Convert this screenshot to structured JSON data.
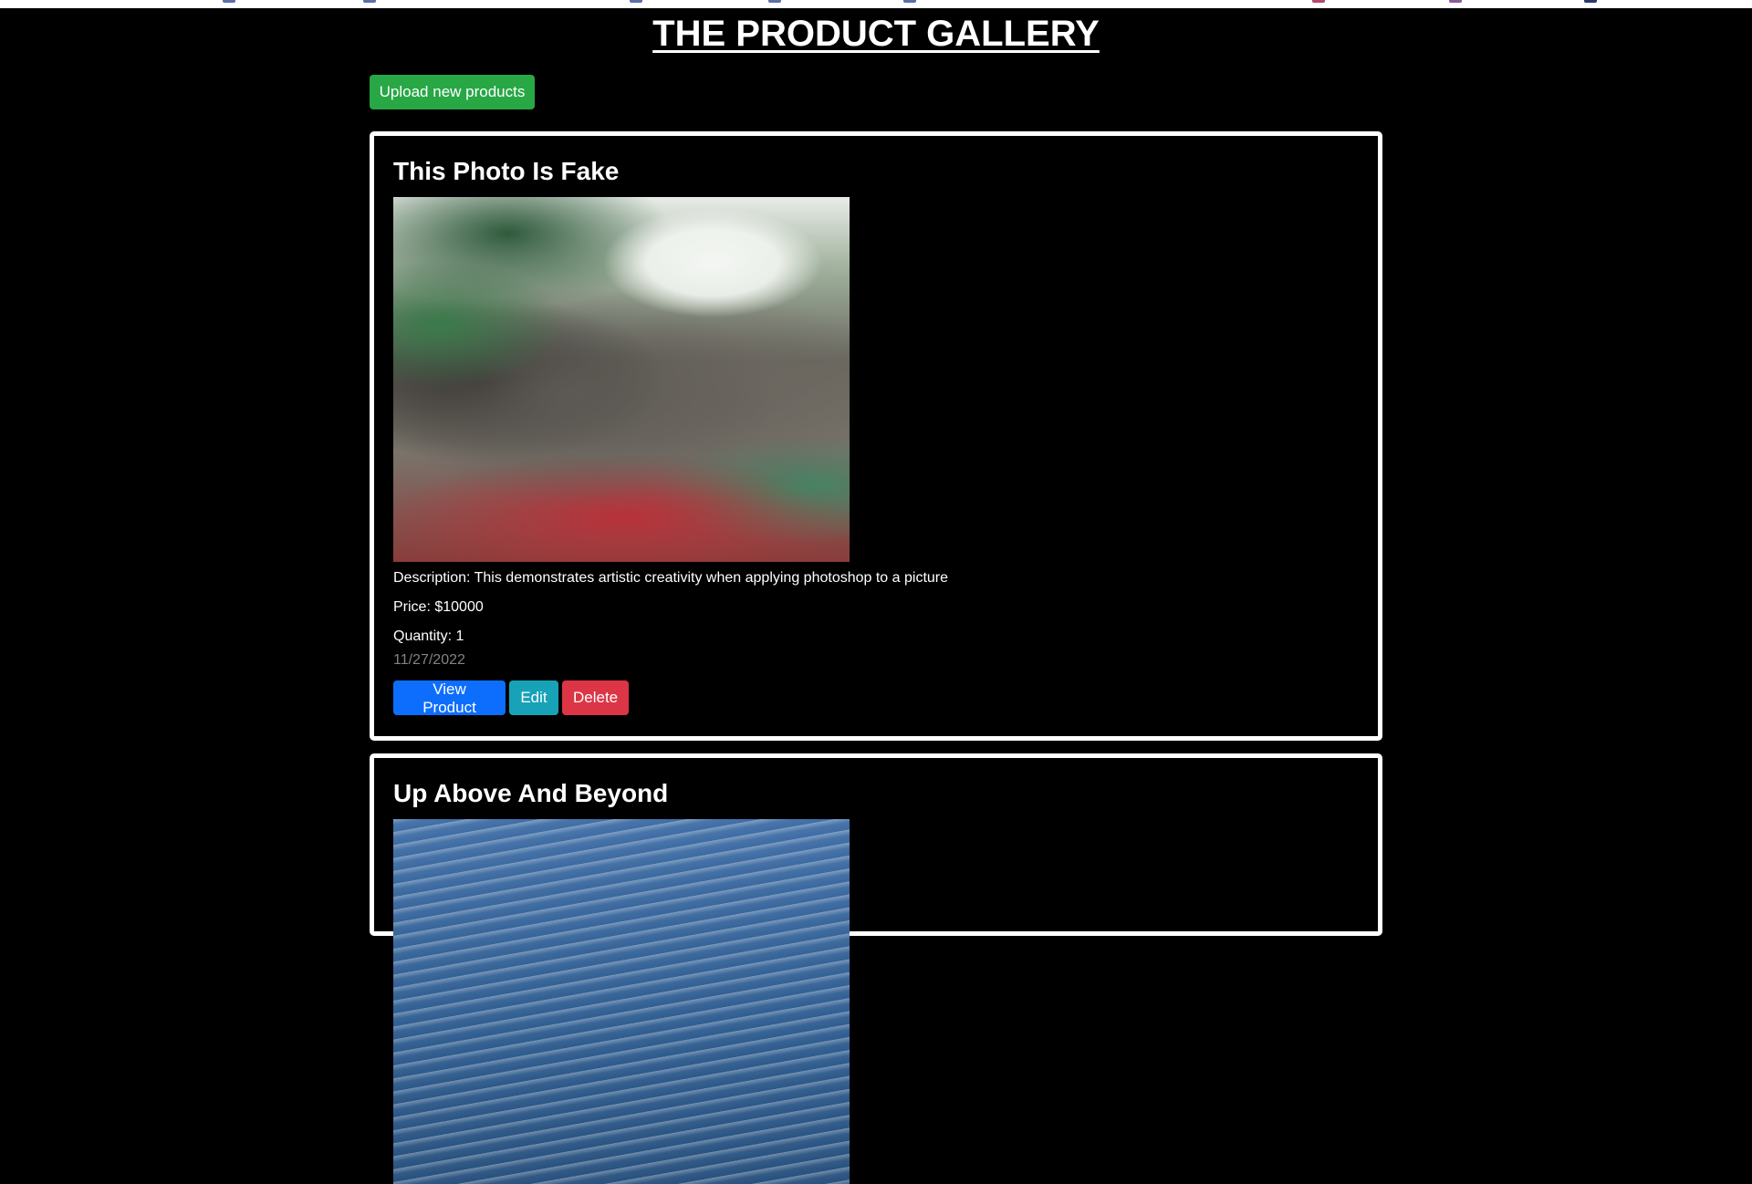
{
  "page": {
    "title": "THE PRODUCT GALLERY",
    "upload_label": "Upload new products"
  },
  "products": [
    {
      "title": "This Photo Is Fake",
      "image": "photo-logs-grass",
      "description": "Description: This demonstrates artistic creativity when applying photoshop to a picture",
      "price": "Price: $10000",
      "quantity": "Quantity: 1",
      "date": "11/27/2022",
      "view_label": "View Product",
      "edit_label": "Edit",
      "delete_label": "Delete"
    },
    {
      "title": "Up Above And Beyond",
      "image": "photo-ocean-waves"
    }
  ],
  "colors": {
    "background": "#000000",
    "upload": "#28a745",
    "view": "#0d6efd",
    "edit": "#17a2b8",
    "delete": "#dc3545",
    "date_text": "#7f8287"
  }
}
